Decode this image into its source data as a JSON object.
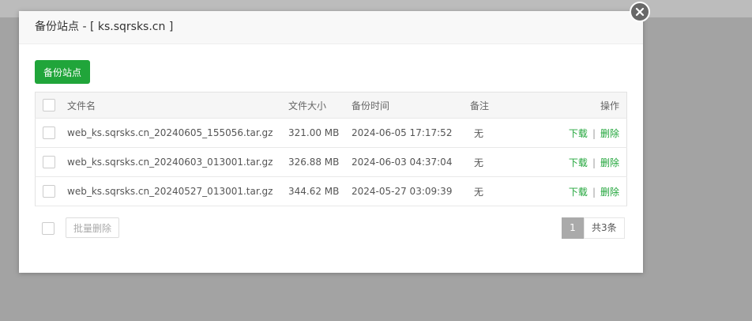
{
  "dialog": {
    "title": "备份站点 - [ ks.sqrsks.cn ]"
  },
  "toolbar": {
    "backup_button": "备份站点"
  },
  "table": {
    "headers": [
      "文件名",
      "文件大小",
      "备份时间",
      "备注",
      "操作"
    ],
    "rows": [
      {
        "filename": "web_ks.sqrsks.cn_20240605_155056.tar.gz",
        "size": "321.00 MB",
        "time": "2024-06-05 17:17:52",
        "note": "无",
        "download": "下载",
        "delete": "删除"
      },
      {
        "filename": "web_ks.sqrsks.cn_20240603_013001.tar.gz",
        "size": "326.88 MB",
        "time": "2024-06-03 04:37:04",
        "note": "无",
        "download": "下载",
        "delete": "删除"
      },
      {
        "filename": "web_ks.sqrsks.cn_20240527_013001.tar.gz",
        "size": "344.62 MB",
        "time": "2024-05-27 03:09:39",
        "note": "无",
        "download": "下载",
        "delete": "删除"
      }
    ]
  },
  "footer": {
    "batch_delete": "批量删除",
    "current_page": "1",
    "total_label": "共3条"
  },
  "colors": {
    "accent": "#20a53a",
    "overlay": "#a3a3a3"
  }
}
